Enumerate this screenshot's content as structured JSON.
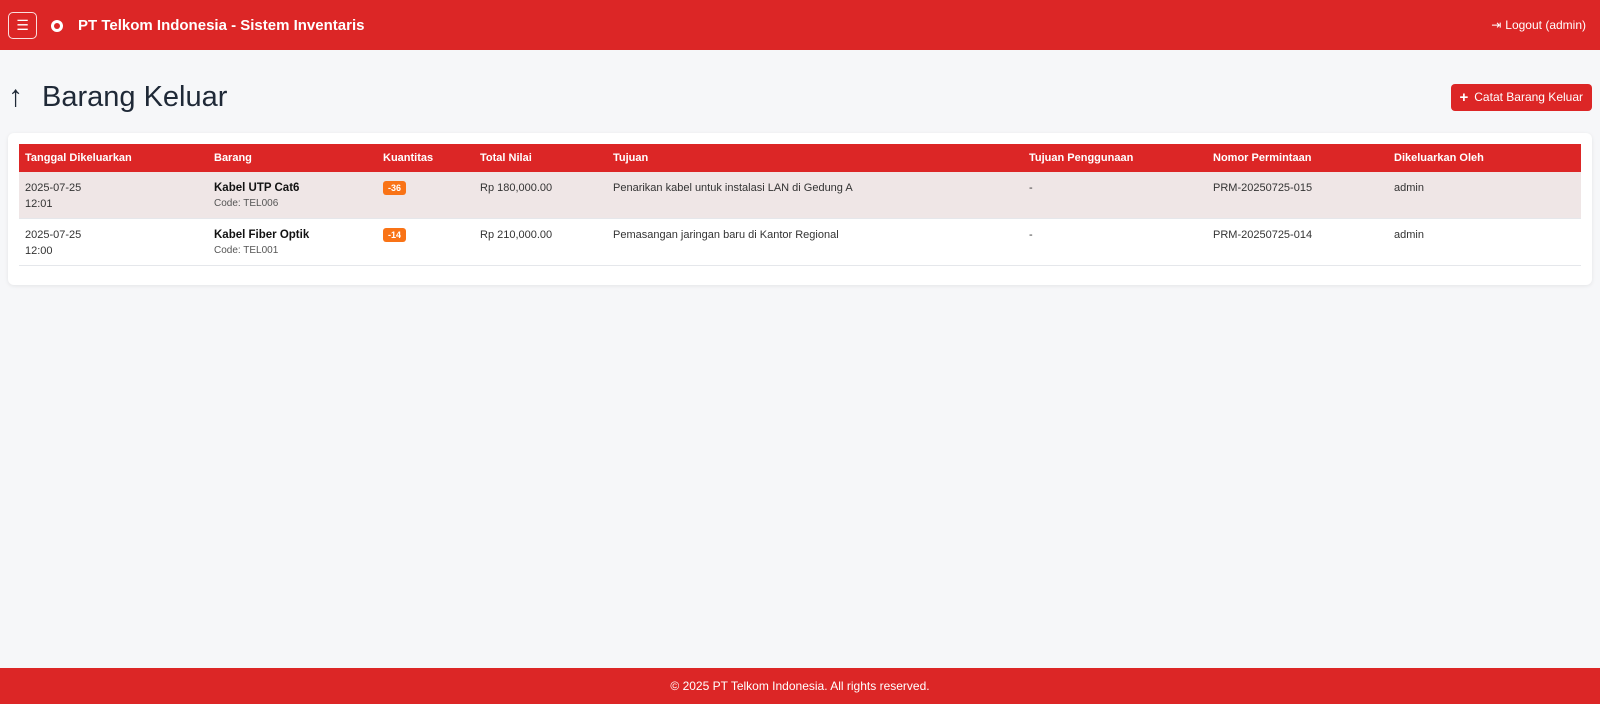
{
  "navbar": {
    "menu_icon": "☰",
    "brand": "PT Telkom Indonesia - Sistem Inventaris",
    "logout_icon": "⇥",
    "logout_label": "Logout (admin)"
  },
  "page": {
    "title_icon": "↑",
    "title": "Barang Keluar",
    "add_icon": "+",
    "add_label": "Catat Barang Keluar"
  },
  "table": {
    "headers": [
      "Tanggal Dikeluarkan",
      "Barang",
      "Kuantitas",
      "Total Nilai",
      "Tujuan",
      "Tujuan Penggunaan",
      "Nomor Permintaan",
      "Dikeluarkan Oleh"
    ],
    "rows": [
      {
        "date": "2025-07-25",
        "time": "12:01",
        "item_name": "Kabel UTP Cat6",
        "item_code": "Code: TEL006",
        "quantity": "-36",
        "total": "Rp 180,000.00",
        "tujuan": "Penarikan kabel untuk instalasi LAN di Gedung A",
        "penggunaan": "-",
        "nomor": "PRM-20250725-015",
        "oleh": "admin"
      },
      {
        "date": "2025-07-25",
        "time": "12:00",
        "item_name": "Kabel Fiber Optik",
        "item_code": "Code: TEL001",
        "quantity": "-14",
        "total": "Rp 210,000.00",
        "tujuan": "Pemasangan jaringan baru di Kantor Regional",
        "penggunaan": "-",
        "nomor": "PRM-20250725-014",
        "oleh": "admin"
      }
    ]
  },
  "footer": {
    "text": "© 2025 PT Telkom Indonesia. All rights reserved."
  },
  "colors": {
    "brand_red": "#dc2626",
    "badge_orange": "#f97316",
    "background": "#f6f7f9"
  }
}
